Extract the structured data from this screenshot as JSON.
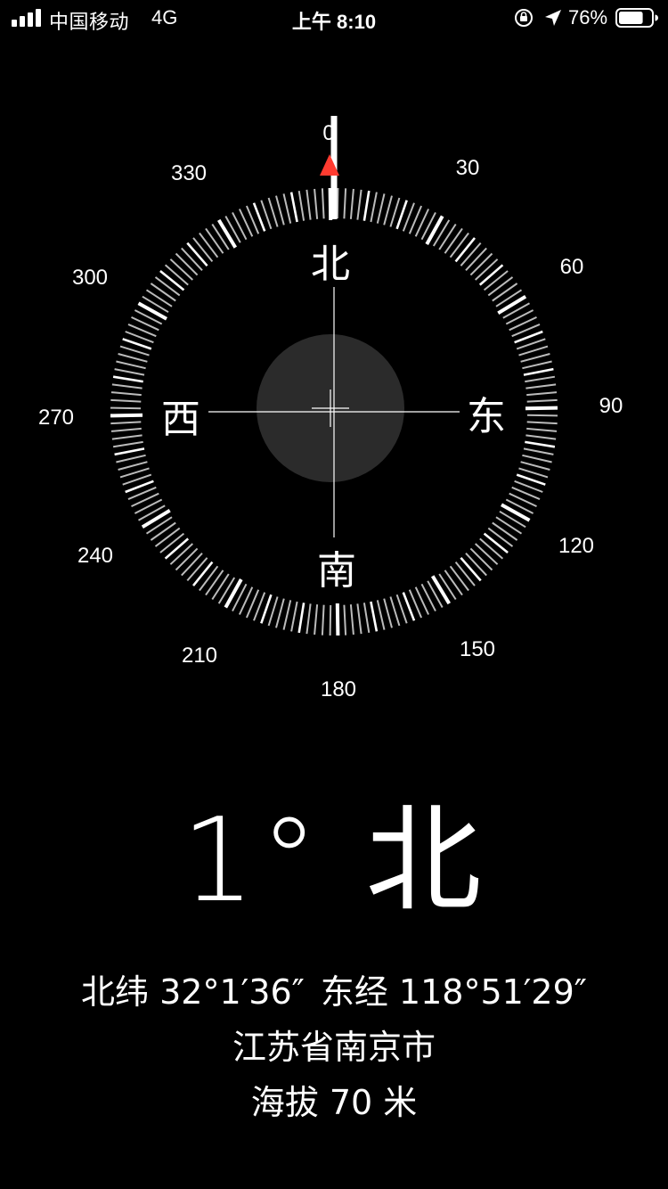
{
  "status_bar": {
    "carrier": "中国移动",
    "network": "4G",
    "time": "上午 8:10",
    "battery_percent": "76%",
    "battery_level": 0.76,
    "icons": [
      "signal-icon",
      "rotation-lock-icon",
      "location-arrow-icon",
      "battery-icon"
    ]
  },
  "compass": {
    "heading_degrees": 1,
    "degree_labels": [
      "0",
      "30",
      "60",
      "90",
      "120",
      "150",
      "180",
      "210",
      "240",
      "270",
      "300",
      "330"
    ],
    "cardinals": {
      "north": "北",
      "east": "东",
      "south": "南",
      "west": "西"
    },
    "accent_color": "#ff3b30"
  },
  "readout": {
    "heading": "1° 北",
    "latitude": "北纬 32°1′36″",
    "longitude": "东经 118°51′29″",
    "city": "江苏省南京市",
    "altitude": "海拔 70 米"
  }
}
